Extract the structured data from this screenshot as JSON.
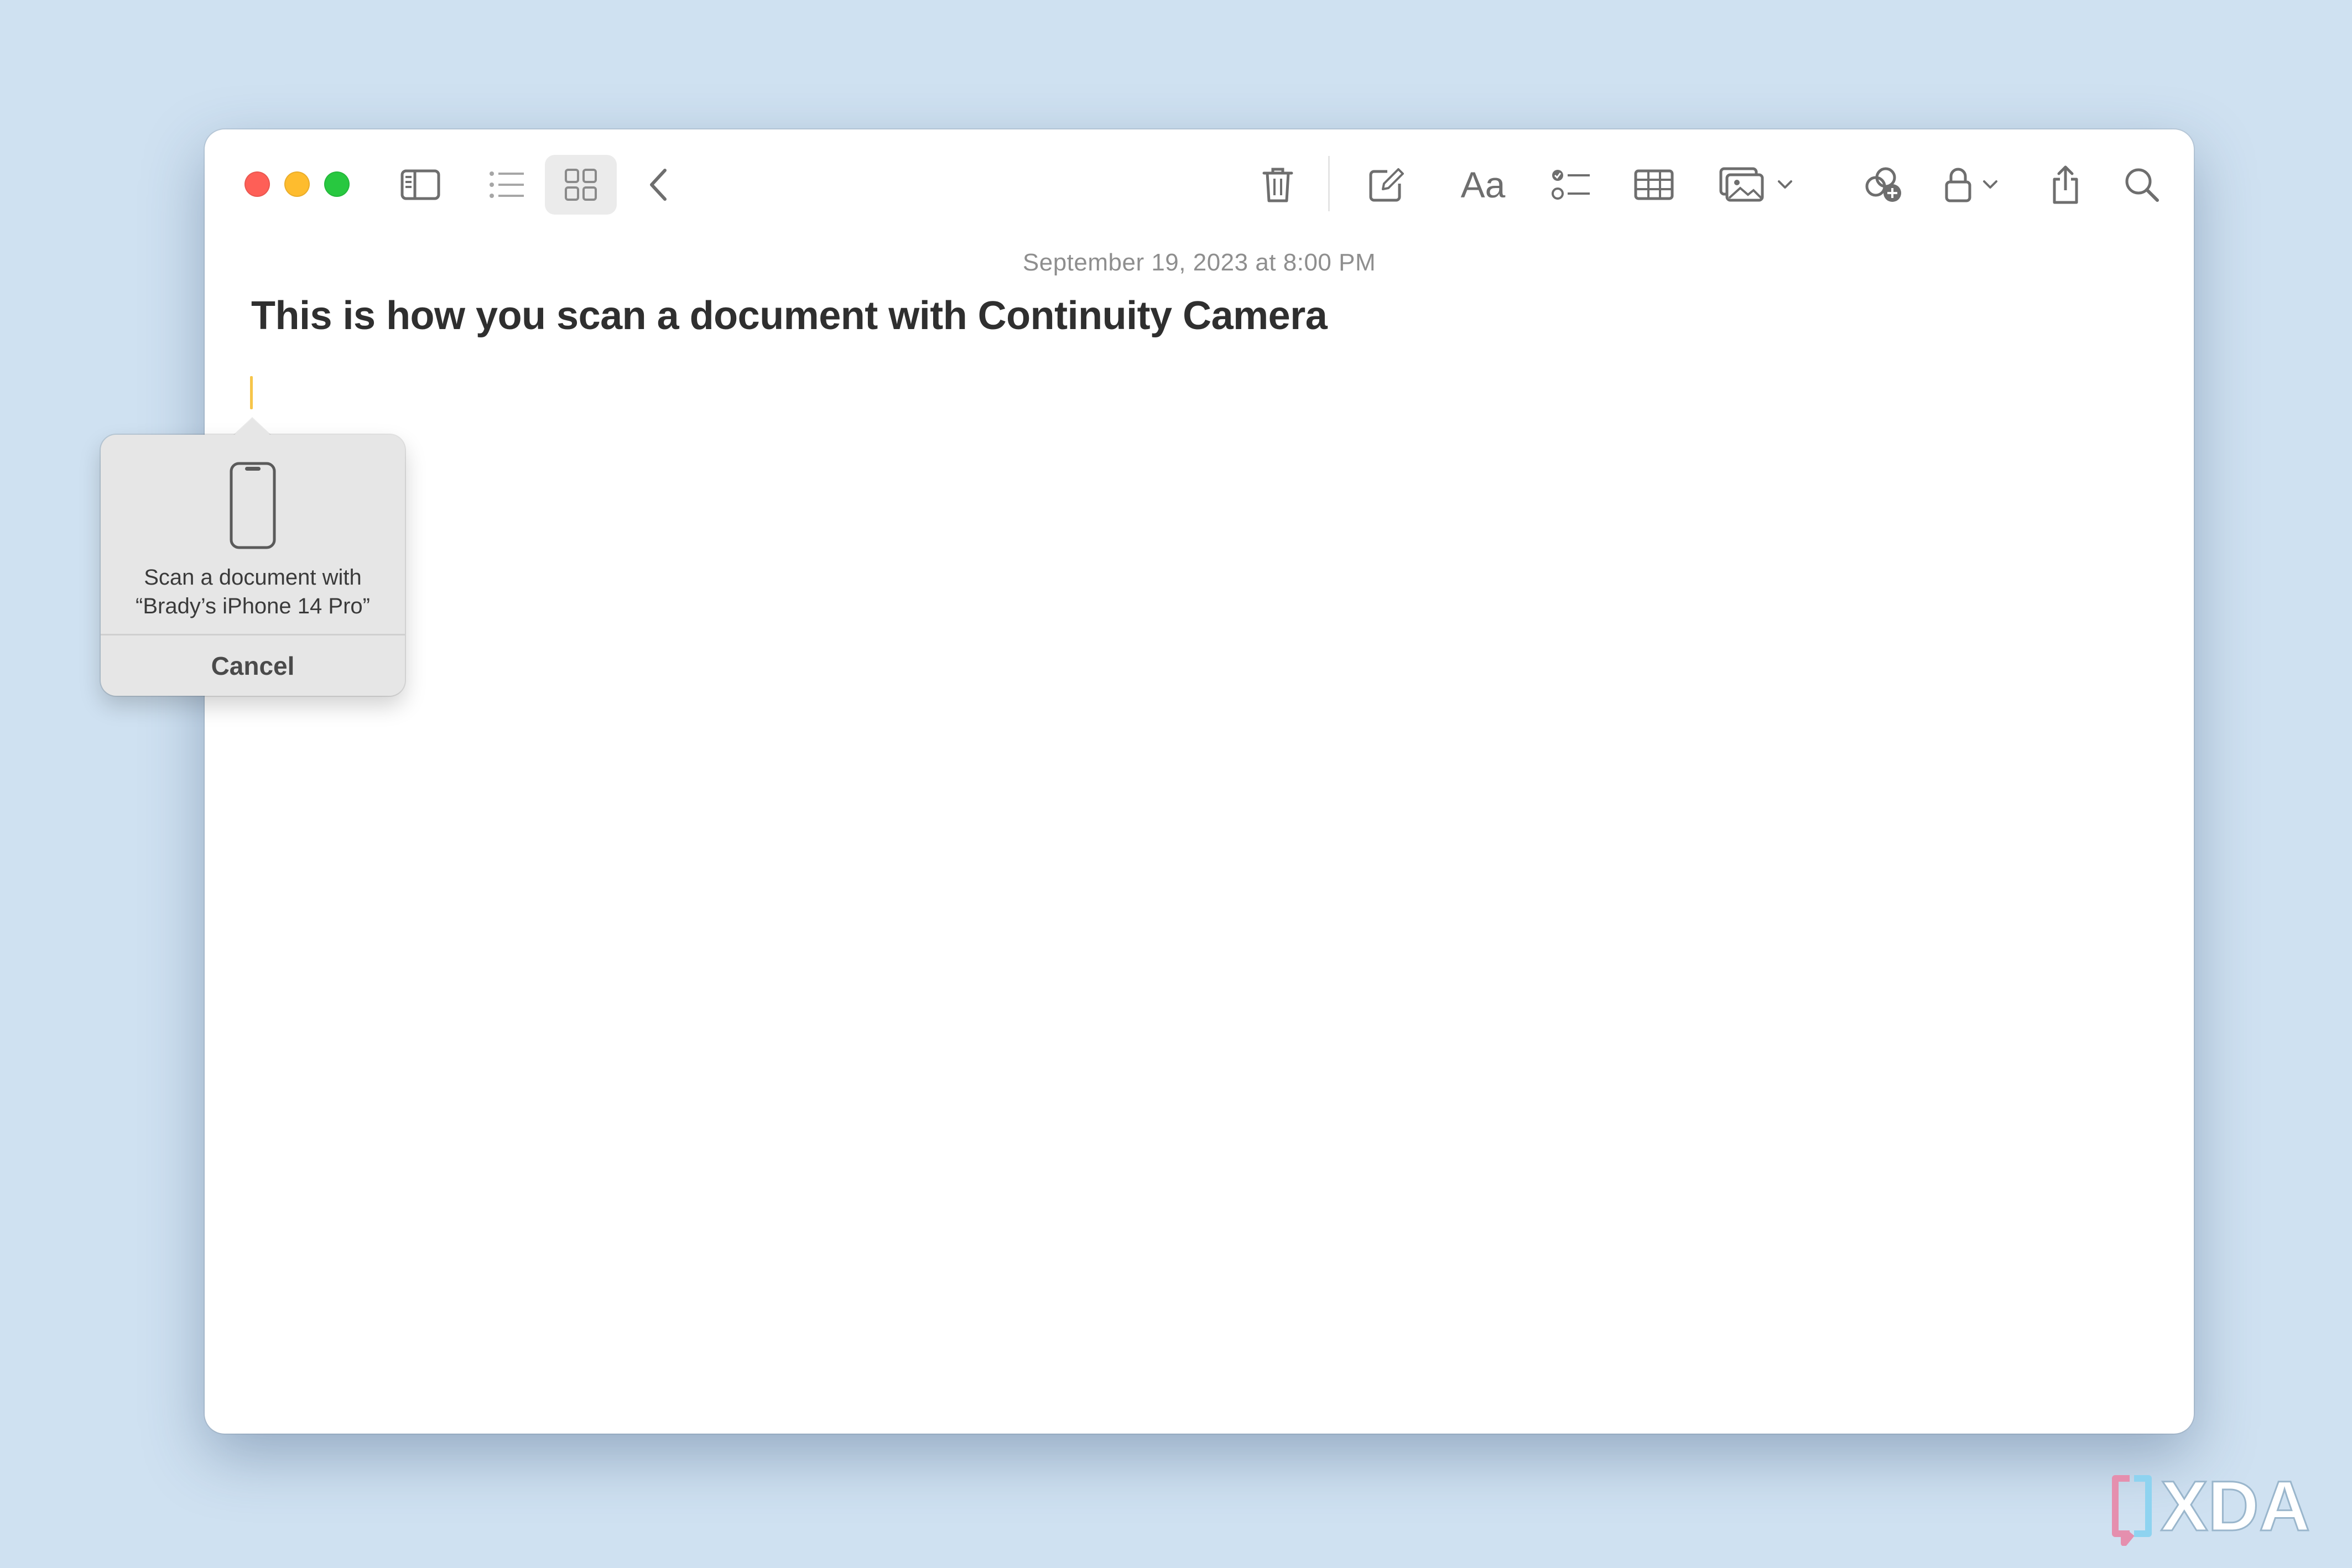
{
  "toolbar": {
    "icons": [
      "sidebar-icon",
      "list-view-icon",
      "gallery-view-icon",
      "back-icon",
      "trash-icon",
      "compose-icon",
      "format-icon",
      "checklist-icon",
      "table-icon",
      "media-icon",
      "collaborate-icon",
      "lock-icon",
      "share-icon",
      "search-icon"
    ],
    "format_label": "Aa"
  },
  "note": {
    "date": "September 19, 2023 at 8:00 PM",
    "title": "This is how you scan a document with Continuity Camera"
  },
  "popover": {
    "line1": "Scan a document with",
    "line2": "“Brady’s iPhone 14 Pro”",
    "cancel_label": "Cancel"
  },
  "watermark": {
    "text": "XDA"
  },
  "colors": {
    "background": "#cfe1f1",
    "close": "#fe5f57",
    "minimize": "#febc2e",
    "zoom": "#28c840",
    "caret": "#f6c54a"
  }
}
